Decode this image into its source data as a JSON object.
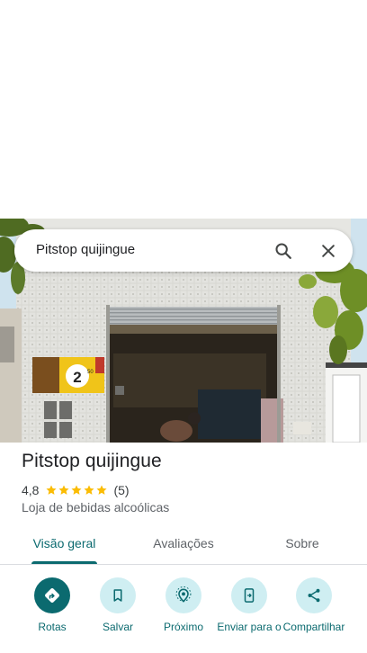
{
  "search": {
    "query": "Pitstop quijingue"
  },
  "place": {
    "name": "Pitstop quijingue",
    "rating": "4,8",
    "rating_stars": 5,
    "review_count": "(5)",
    "category": "Loja de bebidas alcoólicas",
    "photo_sign_text": "2",
    "photo_sign_price": "50"
  },
  "tabs": [
    {
      "label": "Visão geral",
      "active": true
    },
    {
      "label": "Avaliações",
      "active": false
    },
    {
      "label": "Sobre",
      "active": false
    }
  ],
  "actions": [
    {
      "label": "Rotas",
      "icon": "directions-icon"
    },
    {
      "label": "Salvar",
      "icon": "bookmark-icon"
    },
    {
      "label": "Próximo",
      "icon": "nearby-icon"
    },
    {
      "label": "Enviar para o",
      "icon": "send-to-phone-icon"
    },
    {
      "label": "Compartilhar",
      "icon": "share-icon"
    }
  ],
  "colors": {
    "accent": "#0b6a6f",
    "star": "#fbbc04",
    "action_bg": "#cfeef2"
  }
}
